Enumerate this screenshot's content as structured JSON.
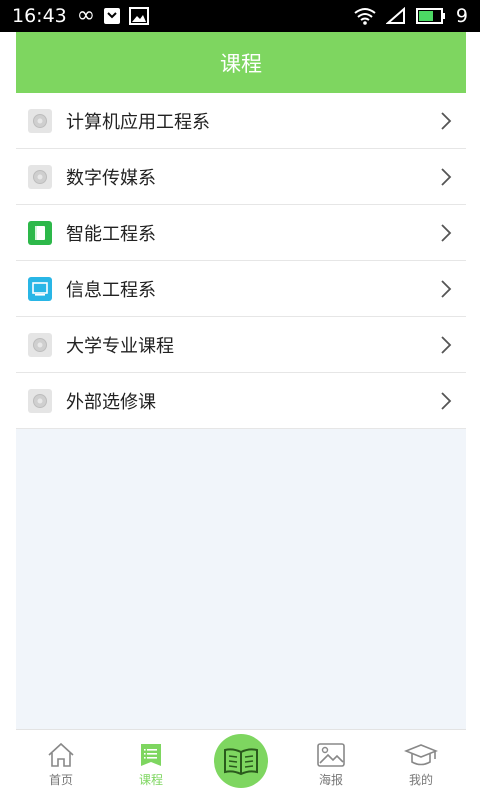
{
  "status_bar": {
    "time": "16:43",
    "battery_level": "9"
  },
  "header": {
    "title": "课程"
  },
  "departments": [
    {
      "label": "计算机应用工程系",
      "icon": "placeholder-image-icon"
    },
    {
      "label": "数字传媒系",
      "icon": "placeholder-image-icon"
    },
    {
      "label": "智能工程系",
      "icon": "book-green-icon"
    },
    {
      "label": "信息工程系",
      "icon": "monitor-blue-icon"
    },
    {
      "label": "大学专业课程",
      "icon": "placeholder-image-icon"
    },
    {
      "label": "外部选修课",
      "icon": "placeholder-image-icon"
    }
  ],
  "tabs": [
    {
      "label": "首页",
      "active": false,
      "icon": "home-icon"
    },
    {
      "label": "课程",
      "active": true,
      "icon": "course-list-icon"
    },
    {
      "label": "",
      "icon": "open-book-icon"
    },
    {
      "label": "海报",
      "active": false,
      "icon": "poster-image-icon"
    },
    {
      "label": "我的",
      "active": false,
      "icon": "graduation-cap-icon"
    }
  ],
  "colors": {
    "accent": "#7ed660",
    "background": "#f1f5fa"
  }
}
